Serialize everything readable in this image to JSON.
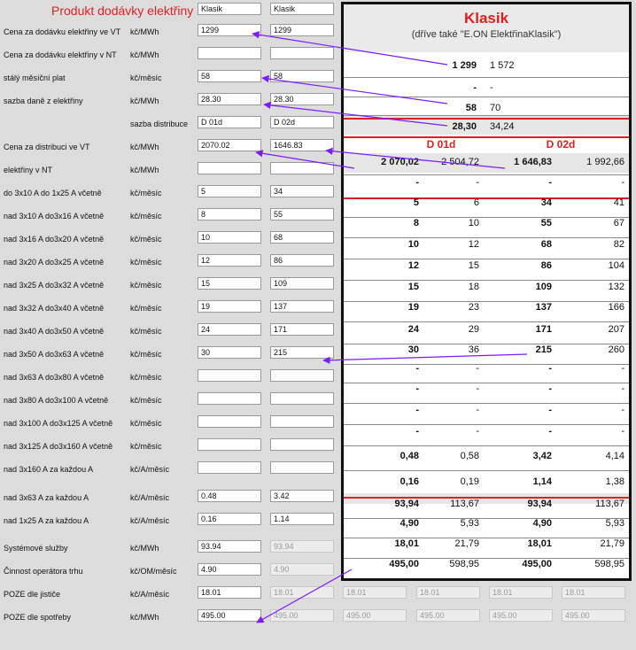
{
  "form": {
    "title": "Produkt dodávky elektřiny",
    "title_inputs": [
      "Klasik",
      "Klasik"
    ],
    "rows": [
      {
        "label": "Cena za dodávku elektřiny ve VT",
        "unit": "kč/MWh",
        "a": "1299",
        "b": "1299"
      },
      {
        "label": "Cena za dodávku elektřiny v NT",
        "unit": "kč/MWh",
        "a": "",
        "b": ""
      },
      {
        "label": "stálý měsíční plat",
        "unit": "kč/měsíc",
        "a": "58",
        "b": "58"
      },
      {
        "label": "sazba daně z elektřiny",
        "unit": "kč/MWh",
        "a": "28.30",
        "b": "28.30"
      },
      {
        "label": "",
        "unit": "sazba distribuce",
        "a": "D 01d",
        "b": "D 02d"
      },
      {
        "label": "Cena za distribuci ve VT",
        "unit": "kč/MWh",
        "a": "2070.02",
        "b": "1646.83"
      },
      {
        "label": "elektřiny          v NT",
        "unit": "kč/MWh",
        "a": "",
        "b": ""
      },
      {
        "label": "do 3x10 A do 1x25 A včetně",
        "unit": "kč/měsíc",
        "a": "5",
        "b": "34"
      },
      {
        "label": "nad 3x10 A do3x16 A včetně",
        "unit": "kč/měsíc",
        "a": "8",
        "b": "55"
      },
      {
        "label": "nad 3x16 A do3x20 A včetně",
        "unit": "kč/měsíc",
        "a": "10",
        "b": "68"
      },
      {
        "label": "nad 3x20 A do3x25 A včetně",
        "unit": "kč/měsíc",
        "a": "12",
        "b": "86"
      },
      {
        "label": "nad 3x25 A do3x32 A včetně",
        "unit": "kč/měsíc",
        "a": "15",
        "b": "109"
      },
      {
        "label": "nad 3x32 A do3x40 A včetně",
        "unit": "kč/měsíc",
        "a": "19",
        "b": "137"
      },
      {
        "label": "nad 3x40 A do3x50 A včetně",
        "unit": "kč/měsíc",
        "a": "24",
        "b": "171"
      },
      {
        "label": "nad 3x50 A do3x63 A včetně",
        "unit": "kč/měsíc",
        "a": "30",
        "b": "215"
      },
      {
        "label": "nad 3x63 A do3x80 A včetně",
        "unit": "kč/měsíc",
        "a": "",
        "b": ""
      },
      {
        "label": "nad 3x80 A do3x100 A včetně",
        "unit": "kč/měsíc",
        "a": "",
        "b": ""
      },
      {
        "label": "nad 3x100 A do3x125 A včetně",
        "unit": "kč/měsíc",
        "a": "",
        "b": ""
      },
      {
        "label": "nad 3x125 A do3x160 A včetně",
        "unit": "kč/měsíc",
        "a": "",
        "b": ""
      },
      {
        "label": "nad 3x160 A za každou A",
        "unit": "kč/A/měsíc",
        "a": "",
        "b": ""
      },
      {
        "label": "nad 3x63 A za každou A",
        "unit": "kč/A/měsíc",
        "a": "0.48",
        "b": "3.42"
      },
      {
        "label": "nad 1x25 A za každou A",
        "unit": "kč/A/měsíc",
        "a": "0.16",
        "b": "1.14"
      },
      {
        "label": "Systémové služby",
        "unit": "kč/MWh",
        "a": "93.94",
        "b": "93.94"
      },
      {
        "label": "Činnost operátora trhu",
        "unit": "kč/OM/měsíc",
        "a": "4.90",
        "b": "4.90"
      },
      {
        "label": "POZE dle jističe",
        "unit": "kč/A/měsíc",
        "a": "18.01",
        "b": "18.01"
      },
      {
        "label": "POZE dle spotřeby",
        "unit": "kč/MWh",
        "a": "495.00",
        "b": "495.00"
      }
    ],
    "extra_cols": [
      [
        "18.01",
        "18.01",
        "18.01",
        "18.01"
      ],
      [
        "495.00",
        "495.00",
        "495.00",
        "495.00"
      ]
    ]
  },
  "panel": {
    "title": "Klasik",
    "subtitle": "(dříve také \"E.ON ElektřinaKlasik\")",
    "top_rows": [
      [
        "1 299",
        "1 572"
      ],
      [
        "-",
        "-"
      ],
      [
        "58",
        "70"
      ],
      [
        "28,30",
        "34,24"
      ]
    ],
    "dist_headers": [
      "D 01d",
      "D 02d"
    ],
    "rows": [
      [
        "2 070,02",
        "2 504,72",
        "1 646,83",
        "1 992,66"
      ],
      [
        "-",
        "-",
        "-",
        "-"
      ],
      [
        "5",
        "6",
        "34",
        "41"
      ],
      [
        "8",
        "10",
        "55",
        "67"
      ],
      [
        "10",
        "12",
        "68",
        "82"
      ],
      [
        "12",
        "15",
        "86",
        "104"
      ],
      [
        "15",
        "18",
        "109",
        "132"
      ],
      [
        "19",
        "23",
        "137",
        "166"
      ],
      [
        "24",
        "29",
        "171",
        "207"
      ],
      [
        "30",
        "36",
        "215",
        "260"
      ],
      [
        "-",
        "-",
        "-",
        "-"
      ],
      [
        "-",
        "-",
        "-",
        "-"
      ],
      [
        "-",
        "-",
        "-",
        "-"
      ],
      [
        "-",
        "-",
        "-",
        "-"
      ],
      [
        "0,48",
        "0,58",
        "3,42",
        "4,14"
      ],
      [
        "0,16",
        "0,19",
        "1,14",
        "1,38"
      ],
      [
        "93,94",
        "113,67",
        "93,94",
        "113,67"
      ],
      [
        "4,90",
        "5,93",
        "4,90",
        "5,93"
      ],
      [
        "18,01",
        "21,79",
        "18,01",
        "21,79"
      ],
      [
        "495,00",
        "598,95",
        "495,00",
        "598,95"
      ]
    ]
  },
  "colors": {
    "accent_red": "#e02020",
    "arrow": "#7b1bff"
  }
}
